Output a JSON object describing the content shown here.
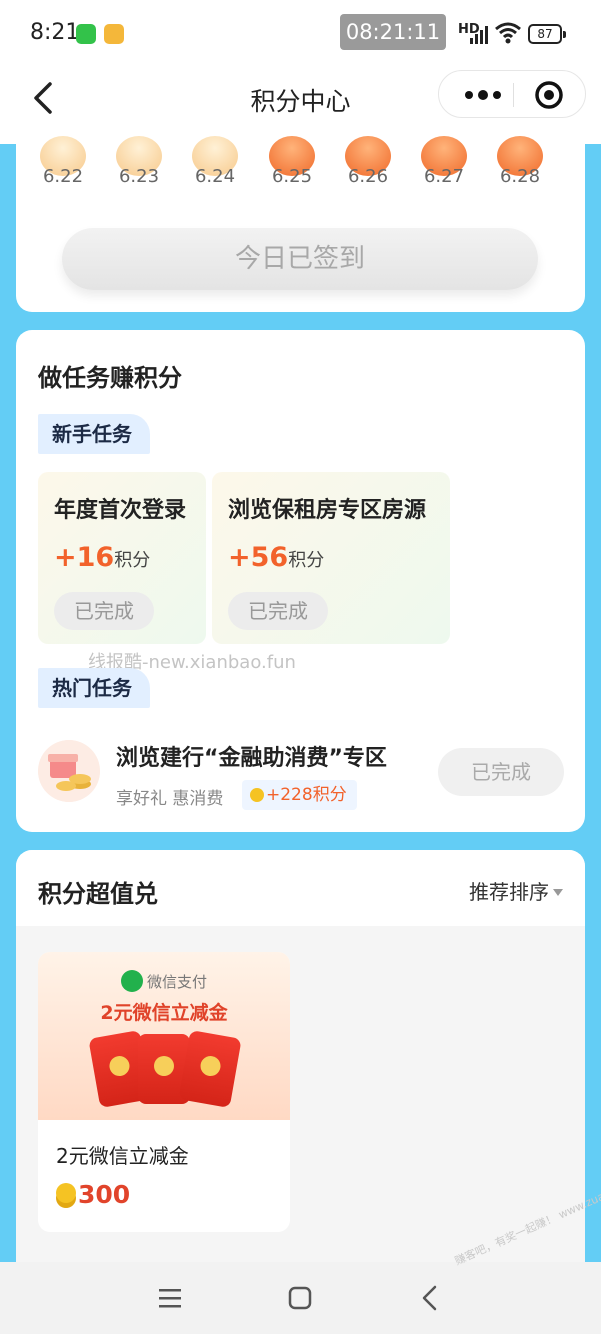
{
  "status_bar": {
    "time": "8:21",
    "clock": "08:21:11",
    "network": "HD",
    "battery": "87",
    "icons": [
      "wechat-icon",
      "notes-icon",
      "signal-icon",
      "wifi-icon",
      "battery-icon"
    ]
  },
  "nav": {
    "title": "积分中心",
    "back_icon": "chevron-left-icon",
    "more_icon": "more-dots-icon",
    "close_icon": "target-close-icon"
  },
  "signin": {
    "days": [
      "6.22",
      "6.23",
      "6.24",
      "6.25",
      "6.26",
      "6.27",
      "6.28"
    ],
    "button_label": "今日已签到"
  },
  "tasks": {
    "title": "做任务赚积分",
    "newbie_tag": "新手任务",
    "newbie_items": [
      {
        "title": "年度首次登录",
        "points": "+16",
        "unit": "积分",
        "status": "已完成"
      },
      {
        "title": "浏览保租房专区房源",
        "points": "+56",
        "unit": "积分",
        "status": "已完成"
      }
    ],
    "watermark": "线报酷-new.xianbao.fun",
    "hot_tag": "热门任务",
    "hot_item": {
      "title": "浏览建行“金融助消费”专区",
      "subtitle": "享好礼 惠消费",
      "points": "+228积分",
      "status": "已完成"
    }
  },
  "exchange": {
    "title": "积分超值兑",
    "sort_label": "推荐排序",
    "products": [
      {
        "pay_label": "微信支付",
        "banner_text": "2元微信立减金",
        "name": "2元微信立减金",
        "price": "300"
      }
    ]
  },
  "bottom_nav": {
    "icons": [
      "menu-icon",
      "home-square-icon",
      "back-triangle-icon"
    ],
    "corner_mark": "赚客吧，有奖一起赚！ www.zuanke8.com"
  },
  "colors": {
    "accent_orange": "#f2622b",
    "page_blue": "#63cdf5",
    "tag_blue": "#e2efff"
  }
}
